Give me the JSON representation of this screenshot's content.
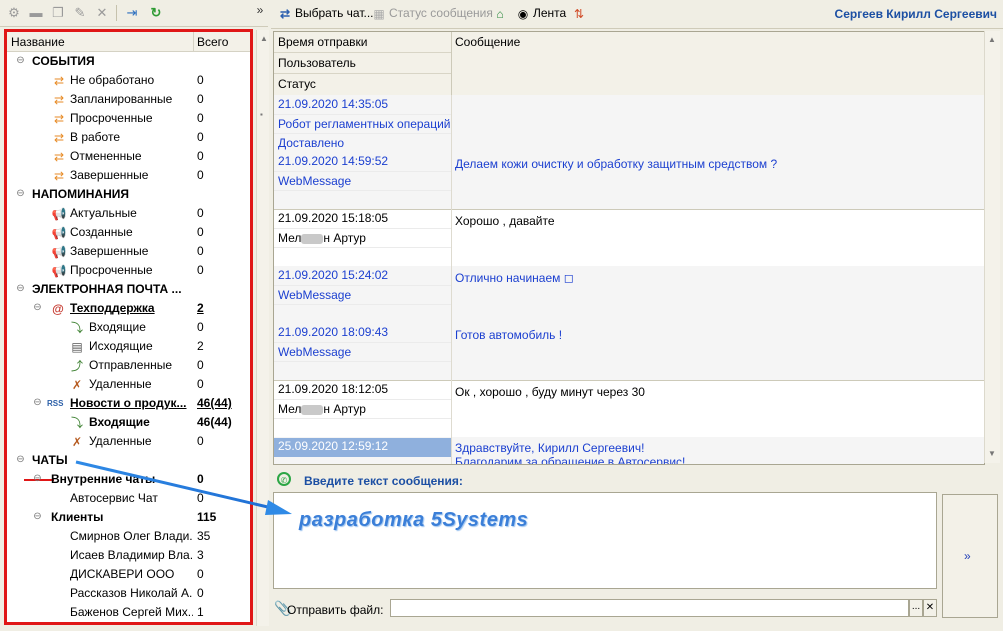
{
  "left_toolbar": {
    "more": "»"
  },
  "tree": {
    "col_name": "Название",
    "col_total": "Всего",
    "rows": [
      {
        "label": "СОБЫТИЯ",
        "value": ""
      },
      {
        "label": "Не обработано",
        "value": "0"
      },
      {
        "label": "Запланированные",
        "value": "0"
      },
      {
        "label": "Просроченные",
        "value": "0"
      },
      {
        "label": "В работе",
        "value": "0"
      },
      {
        "label": "Отмененные",
        "value": "0"
      },
      {
        "label": "Завершенные",
        "value": "0"
      },
      {
        "label": "НАПОМИНАНИЯ",
        "value": ""
      },
      {
        "label": "Актуальные",
        "value": "0"
      },
      {
        "label": "Созданные",
        "value": "0"
      },
      {
        "label": "Завершенные",
        "value": "0"
      },
      {
        "label": "Просроченные",
        "value": "0"
      },
      {
        "label": "ЭЛЕКТРОННАЯ ПОЧТА ...",
        "value": ""
      },
      {
        "label": "Техподдержка",
        "value": "2"
      },
      {
        "label": "Входящие",
        "value": "0"
      },
      {
        "label": "Исходящие",
        "value": "2"
      },
      {
        "label": "Отправленные",
        "value": "0"
      },
      {
        "label": "Удаленные",
        "value": "0"
      },
      {
        "label": "Новости о продук...",
        "value": "46(44)"
      },
      {
        "label": "Входящие",
        "value": "46(44)"
      },
      {
        "label": "Удаленные",
        "value": "0"
      },
      {
        "label": "ЧАТЫ",
        "value": ""
      },
      {
        "label": "Внутренние чаты",
        "value": "0"
      },
      {
        "label": "Автосервис Чат",
        "value": "0"
      },
      {
        "label": "Клиенты",
        "value": "115"
      },
      {
        "label": "Смирнов Олег Влади...",
        "value": "35"
      },
      {
        "label": "Исаев Владимир Вла...",
        "value": "3"
      },
      {
        "label": "ДИСКАВЕРИ ООО",
        "value": "0"
      },
      {
        "label": "Рассказов Николай А...",
        "value": "0"
      },
      {
        "label": "Баженов Сергей Мих...",
        "value": "1"
      }
    ],
    "rss_label": "RSS"
  },
  "right_toolbar": {
    "select_chat": "Выбрать чат...",
    "message_status": "Статус сообщения",
    "feed": "Лента",
    "user": "Сергеев Кирилл Сергеевич"
  },
  "grid": {
    "col_sent_time": "Время отправки",
    "col_user": "Пользователь",
    "col_status": "Статус",
    "col_message": "Сообщение",
    "messages": [
      {
        "time": "21.09.2020 14:35:05",
        "user": "Робот регламентных операций",
        "status": "Доставлено",
        "text": ""
      },
      {
        "time": "21.09.2020 14:59:52",
        "user": "WebMessage",
        "status": "",
        "text": "Делаем кожи очистку и обработку защитным средством ?"
      },
      {
        "time": "21.09.2020 15:18:05",
        "user_prefix": "Мел",
        "user_suffix": "н Артур",
        "status": "",
        "text": "Хорошо , давайте"
      },
      {
        "time": "21.09.2020 15:24:02",
        "user": "WebMessage",
        "status": "",
        "text": "Отлично начинаем  ◻"
      },
      {
        "time": "21.09.2020 18:09:43",
        "user": "WebMessage",
        "status": "",
        "text": "Готов автомобиль !"
      },
      {
        "time": "21.09.2020 18:12:05",
        "user_prefix": "Мел",
        "user_suffix": "н Артур",
        "status": "",
        "text": "Ок , хорошо , буду минут через 30"
      },
      {
        "time": "25.09.2020 12:59:12",
        "user": "",
        "status": "",
        "text": "Здравствуйте, Кирилл Сергеевич!\nБлагодарим за обращение в Автосервис!"
      }
    ]
  },
  "composer": {
    "prompt": "Введите текст сообщения:",
    "send_icon": "»",
    "attach_label": "Отправить файл:",
    "file_value": "",
    "browse": "...",
    "clear": "✕"
  },
  "annotation": {
    "watermark": "разработка 5Systems"
  }
}
